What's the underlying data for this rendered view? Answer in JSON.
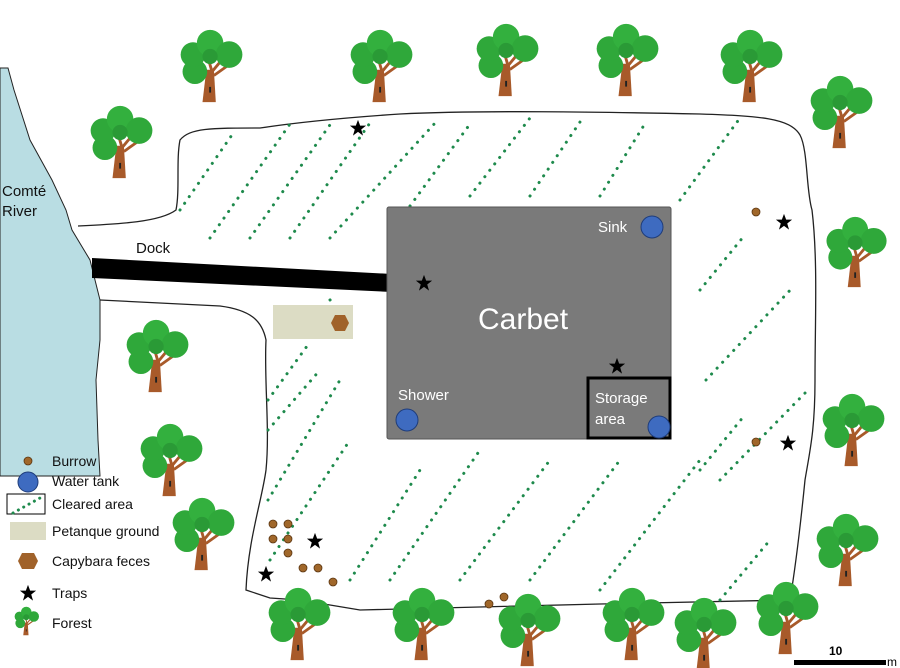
{
  "map": {
    "river_label_line1": "Comté",
    "river_label_line2": "River",
    "dock_label": "Dock",
    "building_label": "Carbet",
    "sink_label": "Sink",
    "shower_label": "Shower",
    "storage_label_line1": "Storage",
    "storage_label_line2": "area"
  },
  "legend": {
    "items": [
      {
        "label": "Burrow",
        "icon": "burrow-icon"
      },
      {
        "label": "Water tank",
        "icon": "water-tank-icon"
      },
      {
        "label": "Cleared area",
        "icon": "cleared-area-icon"
      },
      {
        "label": "Petanque ground",
        "icon": "petanque-ground-icon"
      },
      {
        "label": "Capybara feces",
        "icon": "capybara-feces-icon"
      },
      {
        "label": "Traps",
        "icon": "trap-star-icon"
      },
      {
        "label": "Forest",
        "icon": "tree-icon"
      }
    ]
  },
  "scale_bar": {
    "value": "10",
    "unit": "m"
  },
  "colors": {
    "river": "#b9dde3",
    "building": "#7a7a7a",
    "water_tank": "#3e6bc0",
    "burrow": "#a0672a",
    "cleared_dots": "#1e8a4c",
    "petanque": "#dcdcc4",
    "feces": "#a0622a",
    "tree_canopy": "#2fa83a",
    "tree_trunk": "#a85a2a"
  }
}
